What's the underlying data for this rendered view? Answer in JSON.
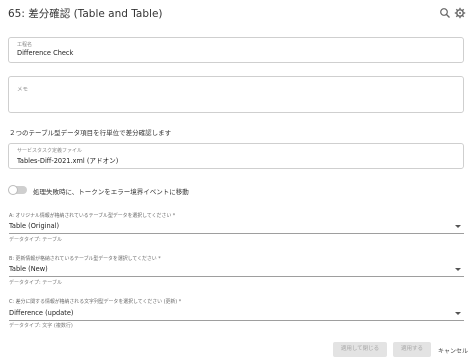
{
  "header": {
    "title": "65: 差分確認 (Table and Table)"
  },
  "icons": {
    "search": "search-icon",
    "settings": "gear-icon",
    "dropdown": "chevron-down-icon"
  },
  "form": {
    "name": {
      "label": "工程名",
      "value": "Difference Check"
    },
    "memo": {
      "label": "メモ",
      "value": ""
    },
    "description": "２つのテーブル型データ項目を行単位で差分確認します",
    "service_task_file": {
      "label": "サービスタスク定義ファイル",
      "value": "Tables-Diff-2021.xml (アドオン)"
    },
    "error_toggle": {
      "label": "処理失敗時に、トークンをエラー境界イベントに移動",
      "checked": false
    },
    "selectors": [
      {
        "label": "A: オリジナル情報が格納されているテーブル型データを選択してください *",
        "value": "Table (Original)",
        "hint": "データタイプ: テーブル"
      },
      {
        "label": "B: 更新情報が格納されているテーブル型データを選択してください *",
        "value": "Table (New)",
        "hint": "データタイプ: テーブル"
      },
      {
        "label": "C: 差分に関する情報が格納される文字列型データを選択してください (更新) *",
        "value": "Difference (update)",
        "hint": "データタイプ: 文字 (複数行)"
      }
    ]
  },
  "footer": {
    "apply_close_label": "適用して閉じる",
    "apply_label": "適用する",
    "cancel_label": "キャンセル"
  },
  "colors": {
    "border": "#cfcfcf",
    "underline": "#9e9e9e",
    "disabled_button": "#e3e3e3"
  }
}
